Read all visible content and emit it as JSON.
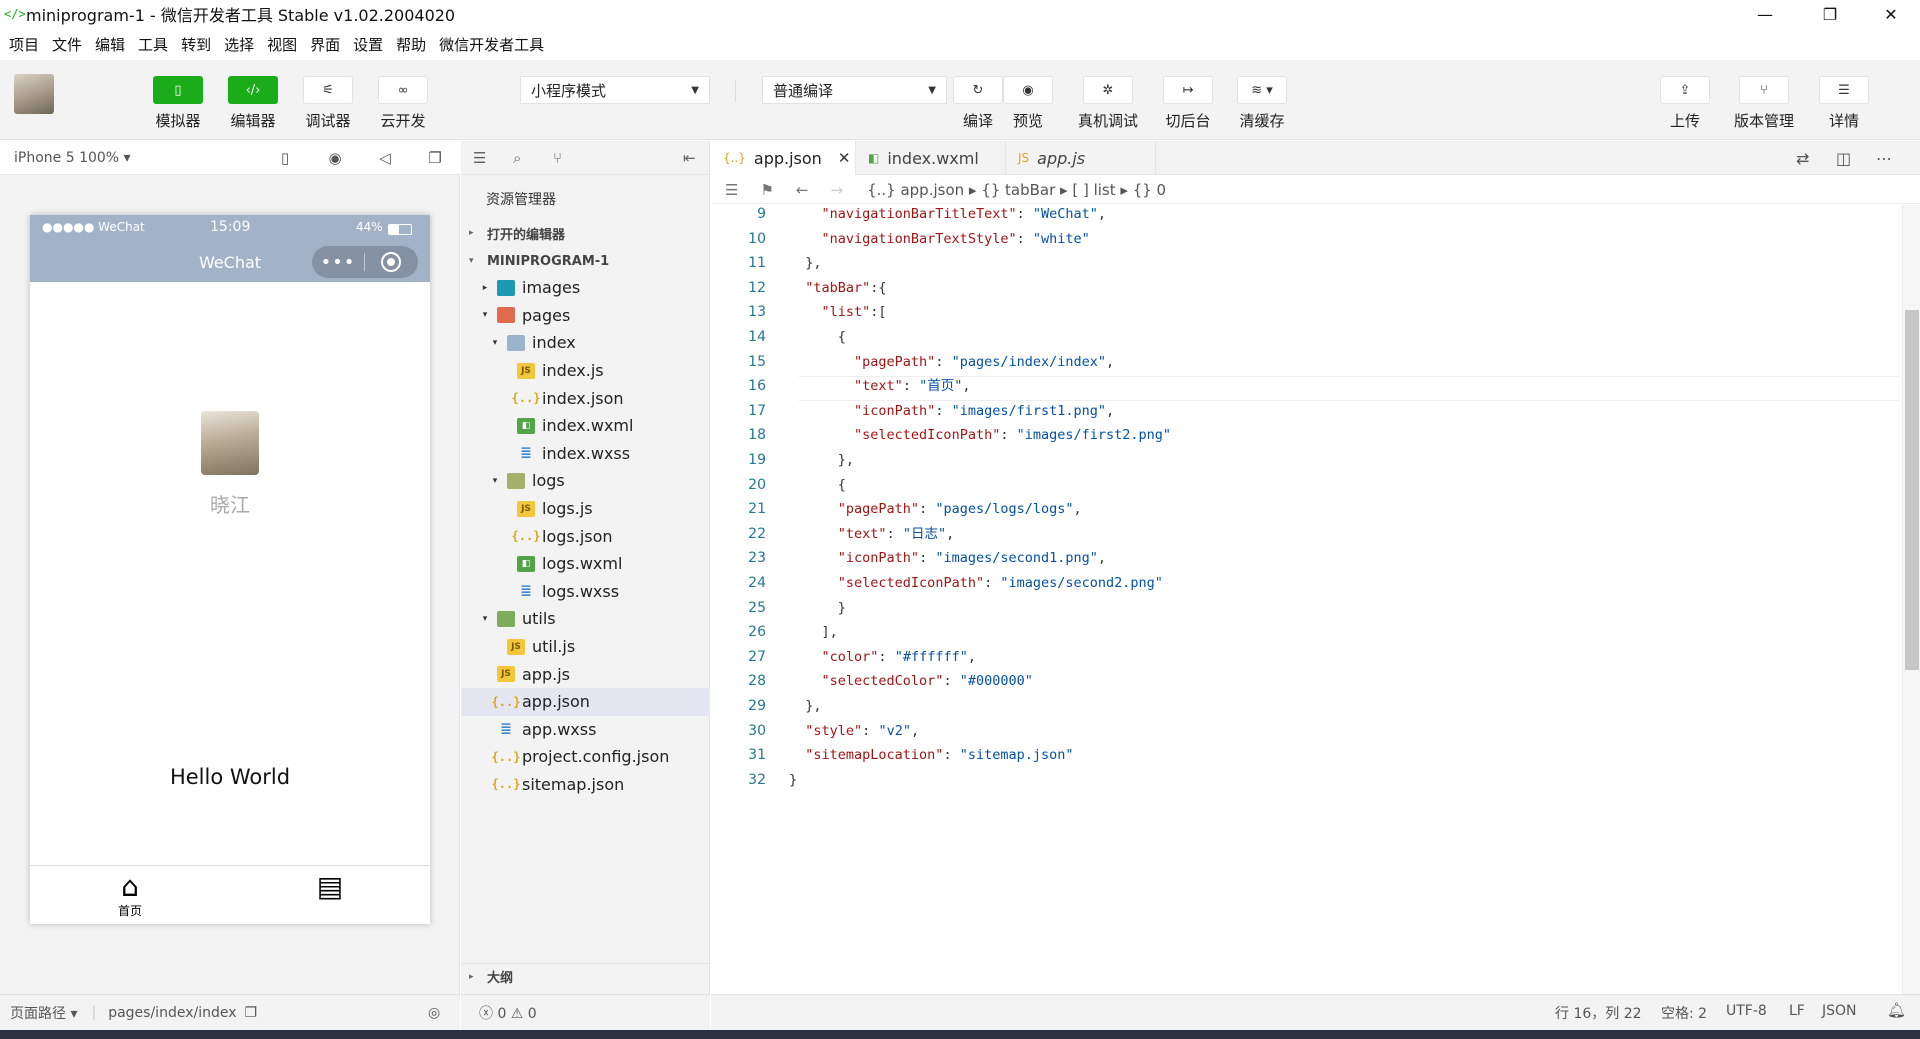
{
  "window": {
    "title": "miniprogram-1 - 微信开发者工具 Stable v1.02.2004020",
    "app_icon": "</>",
    "controls": {
      "minimize": "—",
      "maximize": "❐",
      "close": "✕"
    }
  },
  "menubar": [
    "项目",
    "文件",
    "编辑",
    "工具",
    "转到",
    "选择",
    "视图",
    "界面",
    "设置",
    "帮助",
    "微信开发者工具"
  ],
  "toolbar": {
    "simulator": "模拟器",
    "editor": "编辑器",
    "debugger": "调试器",
    "cloud": "云开发",
    "mode_select": "小程序模式",
    "compile_select": "普通编译",
    "compile": "编译",
    "preview": "预览",
    "real_debug": "真机调试",
    "background": "切后台",
    "clear_cache": "清缓存",
    "upload": "上传",
    "version": "版本管理",
    "details": "详情"
  },
  "simulator": {
    "device": "iPhone 5 100% ▾",
    "carrier": "●●●●● WeChat",
    "time": "15:09",
    "battery": "44%",
    "nav_title": "WeChat",
    "capsule_dots": "•••",
    "nickname": "晓江",
    "hello": "Hello World",
    "tabs": [
      {
        "label": "首页",
        "icon": "⌂"
      },
      {
        "label": "",
        "icon": "▤"
      }
    ]
  },
  "sim_status": {
    "page_path_label": "页面路径 ▾",
    "page_path": "pages/index/index"
  },
  "explorer": {
    "title": "资源管理器",
    "open_editors": "打开的编辑器",
    "project": "MINIPROGRAM-1",
    "outline": "大纲",
    "files": [
      {
        "name": "images",
        "depth": 0,
        "type": "folder-img",
        "tw": "▸"
      },
      {
        "name": "pages",
        "depth": 0,
        "type": "folder-pg",
        "tw": "▾"
      },
      {
        "name": "index",
        "depth": 1,
        "type": "folder-open",
        "tw": "▾"
      },
      {
        "name": "index.js",
        "depth": 2,
        "type": "js",
        "tw": ""
      },
      {
        "name": "index.json",
        "depth": 2,
        "type": "json",
        "tw": ""
      },
      {
        "name": "index.wxml",
        "depth": 2,
        "type": "wxml",
        "tw": ""
      },
      {
        "name": "index.wxss",
        "depth": 2,
        "type": "wxss",
        "tw": ""
      },
      {
        "name": "logs",
        "depth": 1,
        "type": "folder-logs",
        "tw": "▾"
      },
      {
        "name": "logs.js",
        "depth": 2,
        "type": "js",
        "tw": ""
      },
      {
        "name": "logs.json",
        "depth": 2,
        "type": "json",
        "tw": ""
      },
      {
        "name": "logs.wxml",
        "depth": 2,
        "type": "wxml",
        "tw": ""
      },
      {
        "name": "logs.wxss",
        "depth": 2,
        "type": "wxss",
        "tw": ""
      },
      {
        "name": "utils",
        "depth": 0,
        "type": "folder-util",
        "tw": "▾"
      },
      {
        "name": "util.js",
        "depth": 1,
        "type": "js",
        "tw": ""
      },
      {
        "name": "app.js",
        "depth": 0,
        "type": "js",
        "tw": ""
      },
      {
        "name": "app.json",
        "depth": 0,
        "type": "json",
        "tw": "",
        "active": true
      },
      {
        "name": "app.wxss",
        "depth": 0,
        "type": "wxss",
        "tw": ""
      },
      {
        "name": "project.config.json",
        "depth": 0,
        "type": "json",
        "tw": ""
      },
      {
        "name": "sitemap.json",
        "depth": 0,
        "type": "json",
        "tw": ""
      }
    ]
  },
  "problems": "ⓧ 0 ⚠ 0",
  "editor": {
    "tabs": [
      {
        "name": "app.json",
        "icon": "{..}",
        "active": true,
        "close": "✕"
      },
      {
        "name": "index.wxml",
        "icon": "◧",
        "active": false
      },
      {
        "name": "app.js",
        "icon": "JS",
        "active": false
      }
    ],
    "breadcrumb": "{..} app.json ▸ {} tabBar ▸ [ ] list ▸ {} 0",
    "lines": [
      {
        "n": "9",
        "code": "    \"navigationBarTitleText\": \"WeChat\","
      },
      {
        "n": "10",
        "code": "    \"navigationBarTextStyle\": \"white\""
      },
      {
        "n": "11",
        "code": "  },"
      },
      {
        "n": "12",
        "code": "  \"tabBar\":{"
      },
      {
        "n": "13",
        "code": "    \"list\":["
      },
      {
        "n": "14",
        "code": "      {"
      },
      {
        "n": "15",
        "code": "        \"pagePath\": \"pages/index/index\","
      },
      {
        "n": "16",
        "code": "        \"text\": \"首页\","
      },
      {
        "n": "17",
        "code": "        \"iconPath\": \"images/first1.png\","
      },
      {
        "n": "18",
        "code": "        \"selectedIconPath\": \"images/first2.png\""
      },
      {
        "n": "19",
        "code": "      },"
      },
      {
        "n": "20",
        "code": "      {"
      },
      {
        "n": "21",
        "code": "      \"pagePath\": \"pages/logs/logs\","
      },
      {
        "n": "22",
        "code": "      \"text\": \"日志\","
      },
      {
        "n": "23",
        "code": "      \"iconPath\": \"images/second1.png\","
      },
      {
        "n": "24",
        "code": "      \"selectedIconPath\": \"images/second2.png\""
      },
      {
        "n": "25",
        "code": "      }"
      },
      {
        "n": "26",
        "code": "    ],"
      },
      {
        "n": "27",
        "code": "    \"color\": \"#ffffff\","
      },
      {
        "n": "28",
        "code": "    \"selectedColor\": \"#000000\""
      },
      {
        "n": "29",
        "code": "  },"
      },
      {
        "n": "30",
        "code": "  \"style\": \"v2\","
      },
      {
        "n": "31",
        "code": "  \"sitemapLocation\": \"sitemap.json\""
      },
      {
        "n": "32",
        "code": "}"
      }
    ],
    "current_line": "16"
  },
  "status": {
    "position": "行 16，列 22",
    "spaces": "空格: 2",
    "encoding": "UTF-8",
    "eol": "LF",
    "language": "JSON"
  },
  "icons": {
    "simulator": "phone-icon",
    "editor": "code-icon",
    "debugger": "debug-icon",
    "cloud": "cloud-icon",
    "compile": "refresh-icon",
    "preview": "eye-icon",
    "real_debug": "bug-icon",
    "background": "switch-icon",
    "clear_cache": "layers-icon",
    "upload": "upload-icon",
    "version": "branch-icon",
    "details": "menu-icon"
  },
  "colors": {
    "accent": "#1aad19",
    "navbar": "#a2b3c8",
    "json_key": "#a31515",
    "json_string": "#0451a5"
  }
}
